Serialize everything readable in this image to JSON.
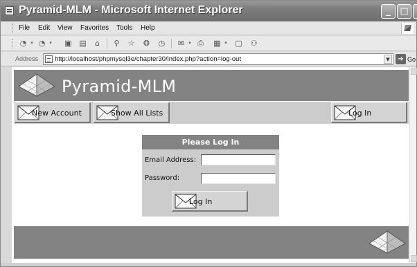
{
  "window": {
    "title": "Pyramid-MLM - Microsoft Internet Explorer",
    "minimize_glyph": "_",
    "maximize_glyph": "□"
  },
  "menubar": {
    "items": [
      "File",
      "Edit",
      "View",
      "Favorites",
      "Tools",
      "Help"
    ]
  },
  "toolbar": {
    "buttons": [
      {
        "name": "back-icon",
        "glyph": "◔"
      },
      {
        "name": "forward-icon",
        "glyph": "◔"
      },
      {
        "name": "stop-icon",
        "glyph": "▣"
      },
      {
        "name": "refresh-icon",
        "glyph": "▤"
      },
      {
        "name": "home-icon",
        "glyph": "⌂"
      },
      {
        "name": "search-icon",
        "glyph": "⚲"
      },
      {
        "name": "favorites-icon",
        "glyph": "☆"
      },
      {
        "name": "media-icon",
        "glyph": "❂"
      },
      {
        "name": "history-icon",
        "glyph": "◷"
      },
      {
        "name": "mail-icon",
        "glyph": "✉"
      },
      {
        "name": "print-icon",
        "glyph": "⎙"
      },
      {
        "name": "edit-icon",
        "glyph": "▦"
      },
      {
        "name": "discuss-icon",
        "glyph": "▢"
      },
      {
        "name": "messenger-icon",
        "glyph": "⚇"
      }
    ]
  },
  "addressbar": {
    "label": "Address",
    "url": "http://localhost/phpmysql3e/chapter30/index.php?action=log-out",
    "go_label": "Go",
    "go_glyph": "➔"
  },
  "page": {
    "site_title": "Pyramid-MLM",
    "nav": {
      "new_account": "New Account",
      "show_all_lists": "Show All Lists",
      "log_in": "Log In"
    },
    "login_form": {
      "title": "Please Log In",
      "email_label": "Email Address:",
      "email_value": "",
      "password_label": "Password:",
      "password_value": "",
      "submit_label": "Log In"
    }
  }
}
